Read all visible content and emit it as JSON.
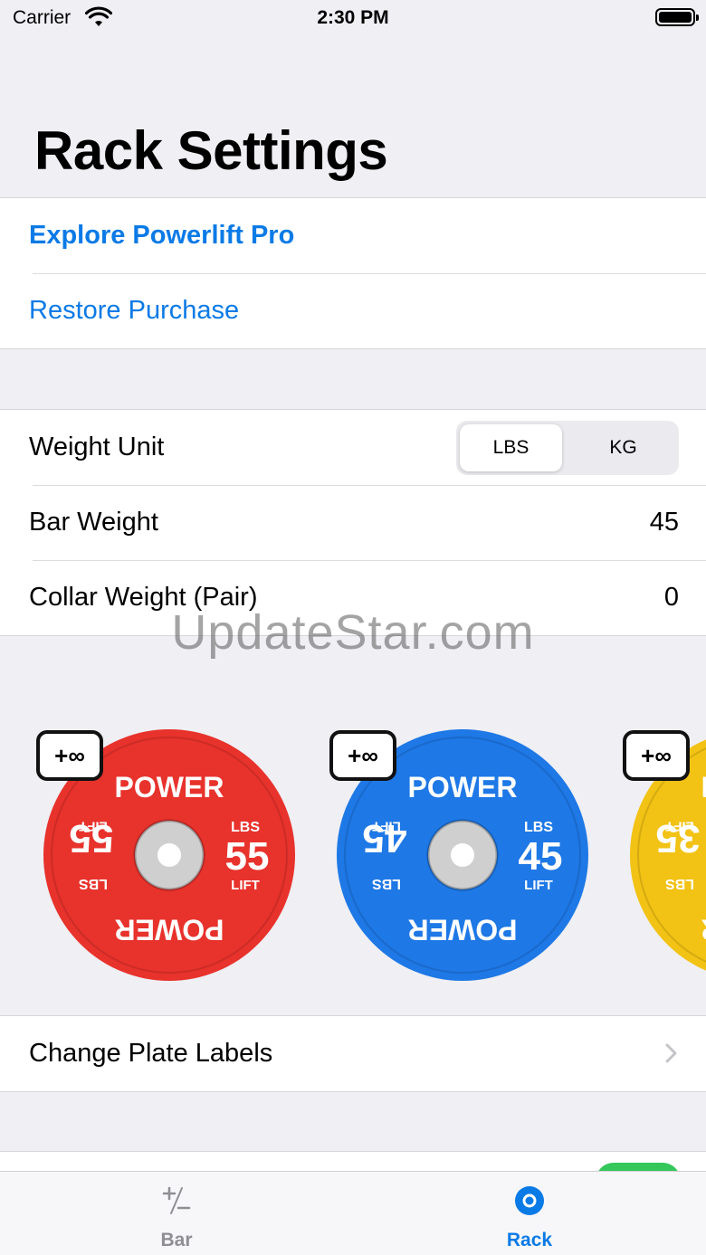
{
  "status_bar": {
    "carrier": "Carrier",
    "time": "2:30 PM"
  },
  "title": "Rack Settings",
  "purchase": {
    "explore": "Explore Powerlift Pro",
    "restore": "Restore Purchase"
  },
  "settings": {
    "weight_unit_label": "Weight Unit",
    "unit_options": [
      "LBS",
      "KG"
    ],
    "unit_selected": "LBS",
    "bar_weight_label": "Bar Weight",
    "bar_weight_value": "45",
    "collar_weight_label": "Collar Weight (Pair)",
    "collar_weight_value": "0"
  },
  "plates": [
    {
      "weight": "55",
      "unit": "LBS",
      "top_word": "POWER",
      "bottom_word": "LIFT",
      "badge": "+∞",
      "color": "#e8322c"
    },
    {
      "weight": "45",
      "unit": "LBS",
      "top_word": "POWER",
      "bottom_word": "LIFT",
      "badge": "+∞",
      "color": "#1e78e6"
    },
    {
      "weight": "35",
      "unit": "LBS",
      "top_word": "POWER",
      "bottom_word": "LIFT",
      "badge": "+∞",
      "color": "#f2c214"
    }
  ],
  "change_plate_labels": "Change Plate Labels",
  "watermark": "UpdateStar.com",
  "tabs": [
    {
      "label": "Bar",
      "icon": "plus-minus-icon",
      "active": false
    },
    {
      "label": "Rack",
      "icon": "rack-circle-icon",
      "active": true
    }
  ],
  "colors": {
    "accent": "#0a7ae6",
    "toggle_on": "#34c759"
  }
}
